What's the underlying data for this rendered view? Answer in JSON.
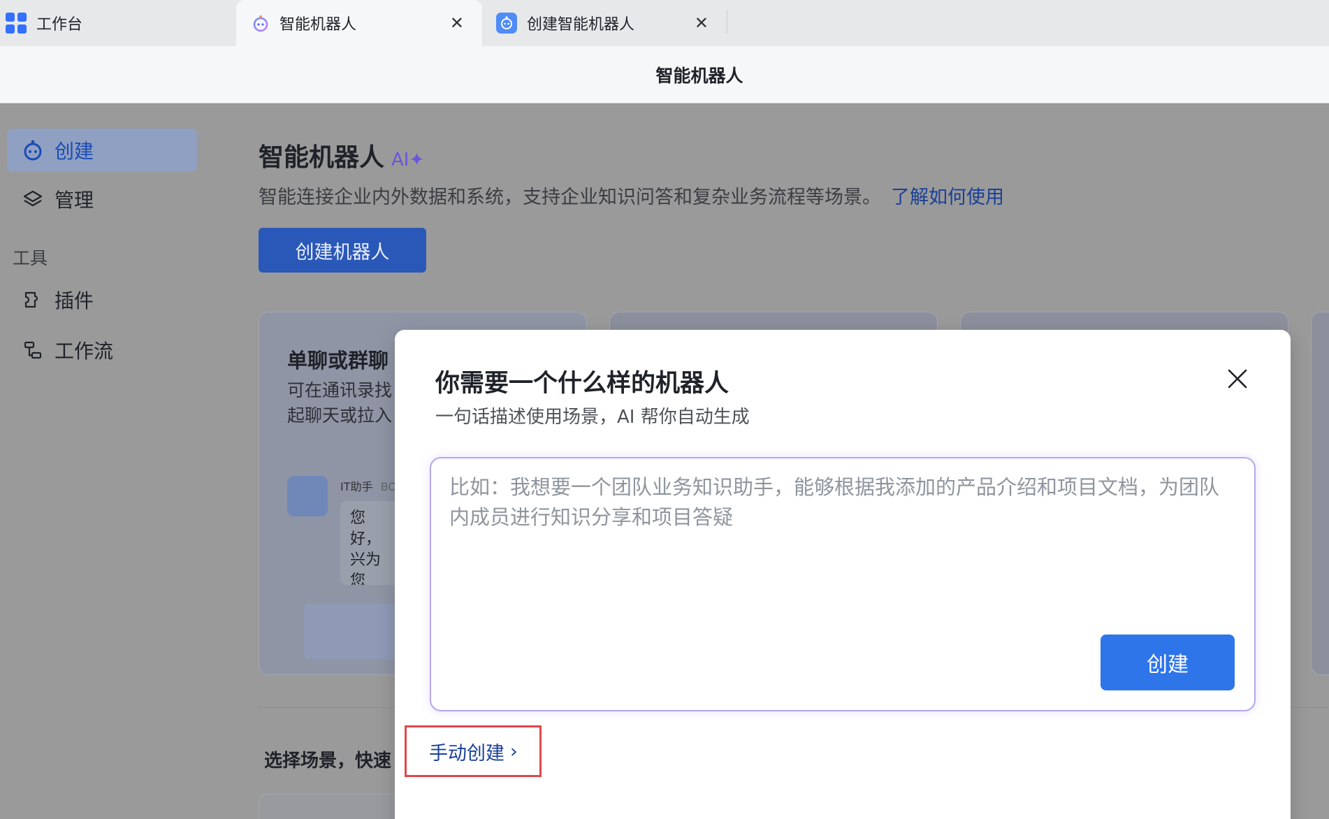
{
  "tabs": [
    {
      "label": "工作台",
      "icon": "workspace-grid-icon"
    },
    {
      "label": "智能机器人",
      "icon": "bot-icon",
      "active": true,
      "close": "✕"
    },
    {
      "label": "创建智能机器人",
      "icon": "bot-icon",
      "close": "✕"
    }
  ],
  "header": {
    "title": "智能机器人"
  },
  "sidebar": {
    "items": [
      {
        "label": "创建",
        "icon": "bot-icon",
        "active": true
      },
      {
        "label": "管理",
        "icon": "layers-icon"
      }
    ],
    "group_label": "工具",
    "tool_items": [
      {
        "label": "插件",
        "icon": "plugin-icon"
      },
      {
        "label": "工作流",
        "icon": "workflow-icon"
      }
    ]
  },
  "main": {
    "title": "智能机器人",
    "ai_badge": "AI✦",
    "description": "智能连接企业内外数据和系统，支持企业知识问答和复杂业务流程等场景。",
    "learn_link": "了解如何使用",
    "create_button": "创建机器人",
    "card1": {
      "title": "单聊或群聊",
      "description": "可在通讯录找起聊天或拉入",
      "bot_name": "IT助手",
      "bot_tag": "BO",
      "bubble": "您好，兴为您题。"
    },
    "scene_title": "选择场景，快速"
  },
  "modal": {
    "title": "你需要一个什么样的机器人",
    "subtitle": "一句话描述使用场景，AI 帮你自动生成",
    "placeholder": "比如：我想要一个团队业务知识助手，能够根据我添加的产品介绍和项目文档，为团队内成员进行知识分享和项目答疑",
    "input_value": "",
    "create_button": "创建",
    "manual_link": "手动创建",
    "manual_chevron": "›"
  },
  "colors": {
    "primary": "#2f75ea",
    "link": "#1a4099",
    "highlight_border": "#e0474c",
    "ai_gradient": "#b7a6f0"
  }
}
